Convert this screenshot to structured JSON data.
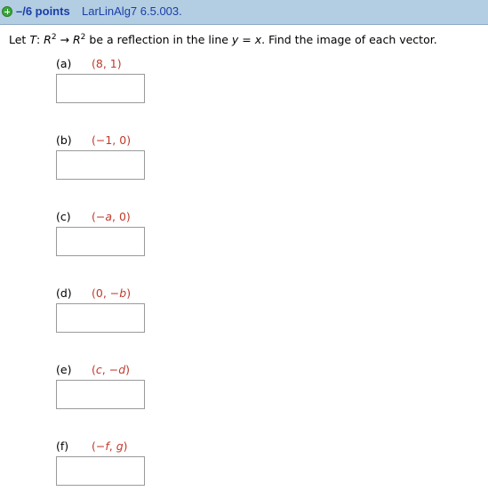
{
  "header": {
    "points": "–/6 points",
    "problem_id": "LarLinAlg7 6.5.003."
  },
  "question": {
    "t1": "Let ",
    "t2": "T",
    "t3": ": ",
    "t4": "R",
    "t5": "2",
    "t6": " → ",
    "t7": "R",
    "t8": "2",
    "t9": " be a reflection in the line ",
    "t10": "y",
    "t11": " = ",
    "t12": "x",
    "t13": ".  Find the image of each vector."
  },
  "parts": [
    {
      "label": "(a)",
      "v1": "(8, 1)",
      "v2": "",
      "v3": "",
      "v4": "",
      "v5": ""
    },
    {
      "label": "(b)",
      "v1": "(−1, 0)",
      "v2": "",
      "v3": "",
      "v4": "",
      "v5": ""
    },
    {
      "label": "(c)",
      "v1": "(−",
      "v2": "a",
      "v3": ", 0)",
      "v4": "",
      "v5": ""
    },
    {
      "label": "(d)",
      "v1": "(0, −",
      "v2": "b",
      "v3": ")",
      "v4": "",
      "v5": ""
    },
    {
      "label": "(e)",
      "v1": "(",
      "v2": "c",
      "v3": ", −",
      "v4": "d",
      "v5": ")"
    },
    {
      "label": "(f)",
      "v1": "(−",
      "v2": "f",
      "v3": ", ",
      "v4": "g",
      "v5": ")"
    }
  ],
  "colors": {
    "header_bg": "#b3cde3",
    "header_text": "#1a3ea8",
    "vector_text": "#c0392b",
    "plus_icon": "#3aa63a"
  },
  "icons": {
    "expand": "plus-circle-icon"
  }
}
